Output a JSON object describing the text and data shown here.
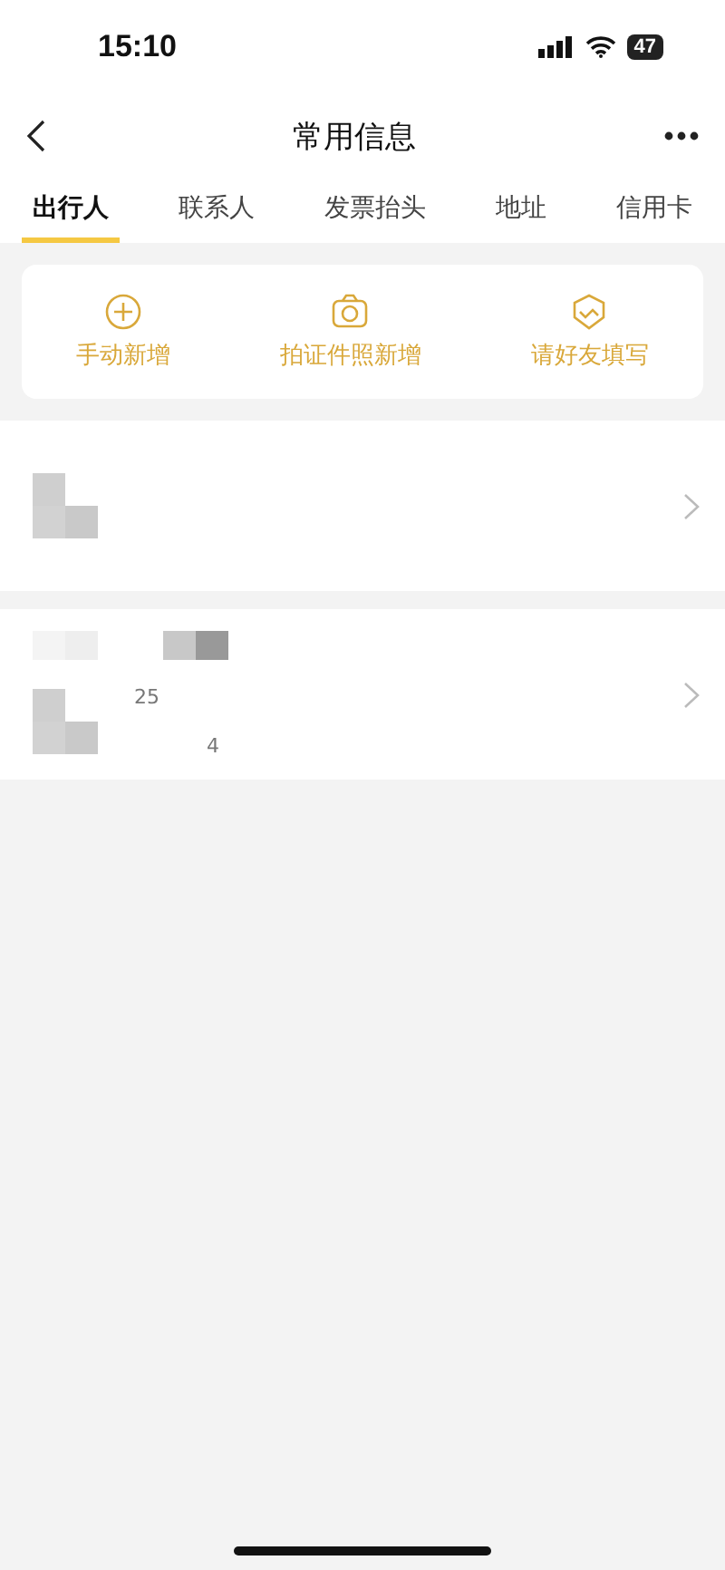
{
  "status_bar": {
    "time": "15:10",
    "battery": "47"
  },
  "header": {
    "title": "常用信息"
  },
  "tabs": [
    {
      "label": "出行人",
      "selected": true
    },
    {
      "label": "联系人",
      "selected": false
    },
    {
      "label": "发票抬头",
      "selected": false
    },
    {
      "label": "地址",
      "selected": false
    },
    {
      "label": "信用卡",
      "selected": false
    }
  ],
  "actions": [
    {
      "kind": "plus",
      "label": "手动新增"
    },
    {
      "kind": "camera",
      "label": "拍证件照新增"
    },
    {
      "kind": "friend",
      "label": "请好友填写"
    }
  ],
  "travelers": [
    {
      "kind": "single"
    },
    {
      "kind": "detailed",
      "text_1": "25",
      "text_2": "4"
    }
  ]
}
